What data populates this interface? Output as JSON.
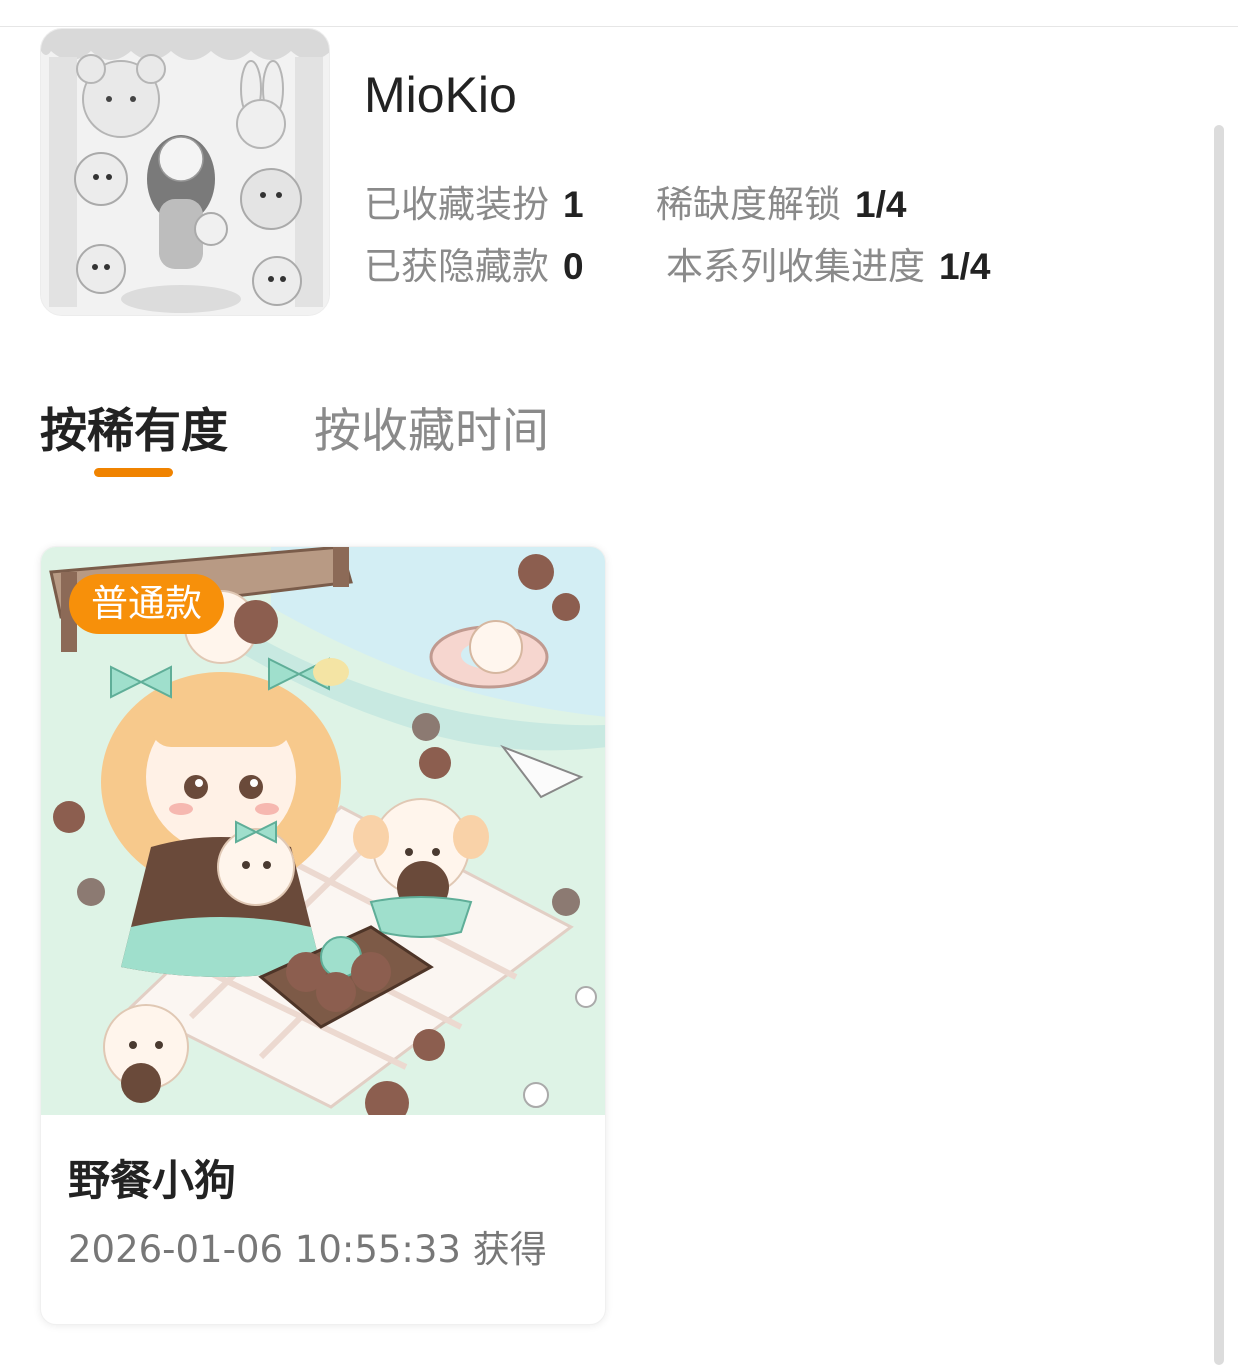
{
  "series": {
    "name": "MioKio",
    "stats": {
      "owned_label": "已收藏装扮",
      "owned_value": "1",
      "rarity_label": "稀缺度解锁",
      "rarity_value": "1/4",
      "hidden_label": "已获隐藏款",
      "hidden_value": "0",
      "progress_label": "本系列收集进度",
      "progress_value": "1/4"
    }
  },
  "tabs": [
    {
      "label": "按稀有度",
      "active": true
    },
    {
      "label": "按收藏时间",
      "active": false
    }
  ],
  "items": [
    {
      "badge": "普通款",
      "name": "野餐小狗",
      "obtained": "2026-01-06 10:55:33 获得"
    }
  ],
  "colors": {
    "accent": "#f08300",
    "badge": "#f7900a",
    "text_primary": "#222222",
    "text_secondary": "#8a8a8a"
  }
}
